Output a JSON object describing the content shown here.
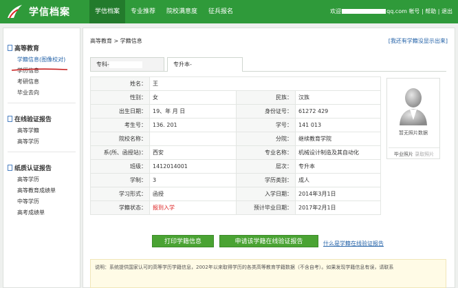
{
  "header": {
    "logo_text": "学信档案",
    "nav": [
      "学信档案",
      "专业推荐",
      "院校满意度",
      "征兵报名"
    ],
    "user_prefix": "欢迎",
    "user_suffix": "qq.com 帐号",
    "help": "帮助",
    "logout": "退出"
  },
  "sidebar": {
    "sections": [
      {
        "title": "高等教育",
        "items": [
          "学籍信息(图像校对)",
          "学历信息",
          "考研信息",
          "毕业去向"
        ]
      },
      {
        "title": "在线验证报告",
        "items": [
          "高等学籍",
          "高等学历"
        ]
      },
      {
        "title": "纸质认证报告",
        "items": [
          "高等学历",
          "高等教育成绩单",
          "中等学历",
          "高考成绩单"
        ]
      }
    ]
  },
  "main": {
    "breadcrumb": "高等教育 > 学籍信息",
    "report_link": "[我还有学籍没显示出来]",
    "tabs": [
      "专科-",
      "专升本-"
    ],
    "rows": [
      [
        {
          "label": "姓名：",
          "value": "王"
        }
      ],
      [
        {
          "label": "性别：",
          "value": "女"
        },
        {
          "label": "民族：",
          "value": "汉族"
        }
      ],
      [
        {
          "label": "出生日期：",
          "value": "19、年 月 日"
        },
        {
          "label": "身份证号：",
          "value": "61272              429"
        }
      ],
      [
        {
          "label": "考生号：",
          "value": "136.              201"
        },
        {
          "label": "学号：",
          "value": "141        013"
        }
      ],
      [
        {
          "label": "院校名称：",
          "value": ""
        },
        {
          "label": "分院：",
          "value": "继续教育学院"
        }
      ],
      [
        {
          "label": "系(所、函授站)：",
          "value": "西安"
        },
        {
          "label": "专业名称：",
          "value": "机械设计制造及其自动化"
        }
      ],
      [
        {
          "label": "班级：",
          "value": "1412014001"
        },
        {
          "label": "层次：",
          "value": "专升本"
        }
      ],
      [
        {
          "label": "学制：",
          "value": "3"
        },
        {
          "label": "学历类别：",
          "value": "成人"
        }
      ],
      [
        {
          "label": "学习形式：",
          "value": "函授"
        },
        {
          "label": "入学日期：",
          "value": "2014年3月1日"
        }
      ],
      [
        {
          "label": "学籍状态：",
          "value": "报到入学",
          "status": true
        },
        {
          "label": "预计毕业日期：",
          "value": "2017年2月1日"
        }
      ]
    ],
    "photo_caption": "暂无照片数据",
    "photo_link1": "毕业照片",
    "photo_link2": "录取照片",
    "btn_print": "打印学籍信息",
    "btn_apply": "申请该学籍在线验证报告",
    "link_what": "什么是学籍在线验证报告",
    "notice": "说明：系统提供国家认可的高等学历学籍信息，2002年以来取得学历的各类高等教育学籍数据（不含自考）。如果发现学籍信息有误，请联系"
  },
  "colors": {
    "brand_green": "#2f9a3a",
    "status_red": "#d22222",
    "link_blue": "#2563a8"
  }
}
